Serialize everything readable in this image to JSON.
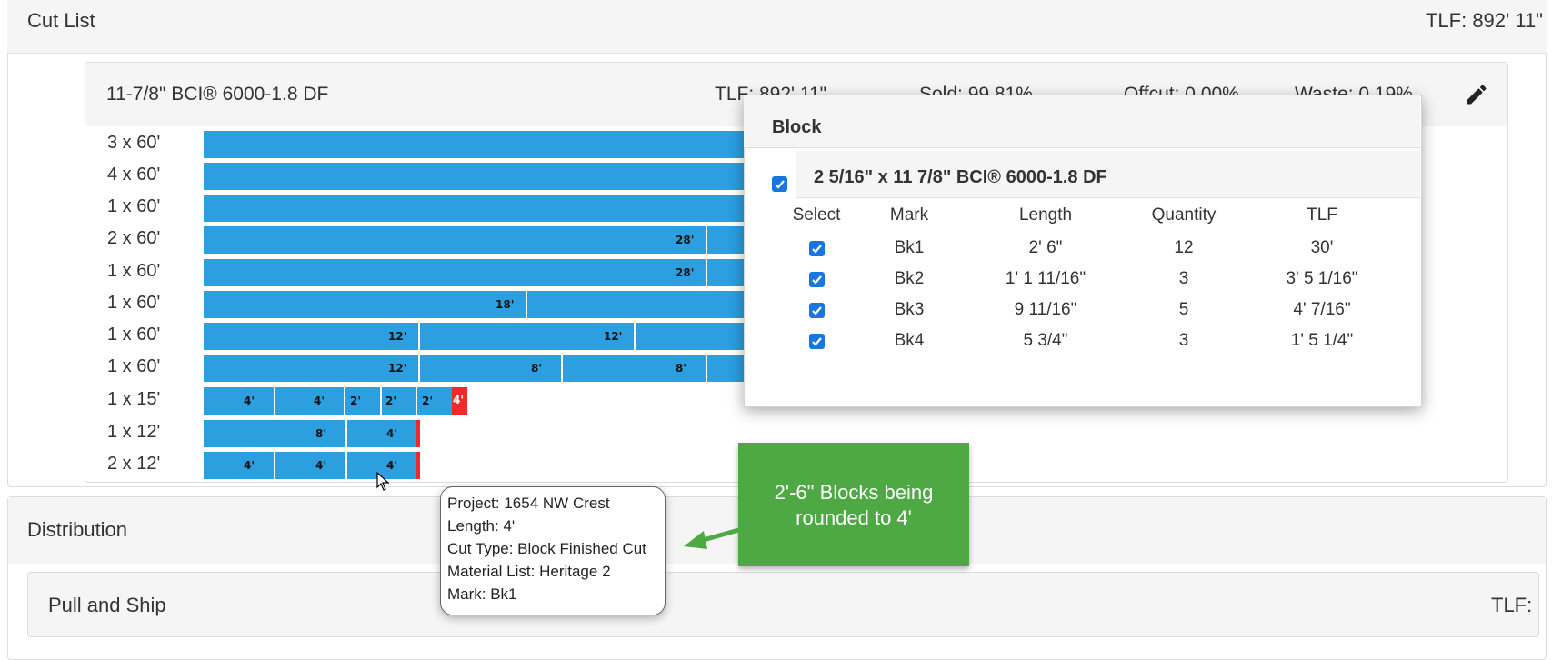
{
  "cut_list": {
    "title": "Cut List",
    "tlf": "TLF: 892' 11\""
  },
  "product": {
    "title": "11-7/8\" BCI® 6000-1.8 DF",
    "tlf": "TLF: 892' 11\"",
    "sold": "Sold: 99.81%",
    "offcut": "Offcut: 0.00%",
    "waste": "Waste: 0.19%",
    "edit_icon": "pencil-icon"
  },
  "rows": [
    {
      "label": "3 x 60'",
      "segments": []
    },
    {
      "label": "4 x 60'",
      "segments": []
    },
    {
      "label": "1 x 60'",
      "segments": []
    },
    {
      "label": "2 x 60'",
      "segments": [
        "28'"
      ]
    },
    {
      "label": "1 x 60'",
      "segments": [
        "28'"
      ]
    },
    {
      "label": "1 x 60'",
      "segments": [
        "18'"
      ]
    },
    {
      "label": "1 x 60'",
      "segments": [
        "12'",
        "12'"
      ]
    },
    {
      "label": "1 x 60'",
      "segments": [
        "12'",
        "8'",
        "8'"
      ]
    },
    {
      "label": "1 x 15'",
      "segments": [
        "4'",
        "4'",
        "2'",
        "2'",
        "2'"
      ],
      "waste": "4'"
    },
    {
      "label": "1 x 12'",
      "segments": [
        "8'",
        "4'"
      ]
    },
    {
      "label": "2 x 12'",
      "segments": [
        "4'",
        "4'",
        "4'"
      ]
    }
  ],
  "block_popup": {
    "title": "Block",
    "group_title": "2 5/16\" x 11 7/8\" BCI® 6000-1.8 DF",
    "columns": [
      "Select",
      "Mark",
      "Length",
      "Quantity",
      "TLF"
    ],
    "items": [
      {
        "mark": "Bk1",
        "length": "2' 6\"",
        "quantity": "12",
        "tlf": "30'"
      },
      {
        "mark": "Bk2",
        "length": "1' 1 11/16\"",
        "quantity": "3",
        "tlf": "3' 5 1/16\""
      },
      {
        "mark": "Bk3",
        "length": "9 11/16\"",
        "quantity": "5",
        "tlf": "4' 7/16\""
      },
      {
        "mark": "Bk4",
        "length": "5 3/4\"",
        "quantity": "3",
        "tlf": "1' 5 1/4\""
      }
    ]
  },
  "tooltip": {
    "lines": [
      "Project: 1654 NW Crest",
      "Length: 4'",
      "Cut Type: Block Finished Cut",
      "Material List: Heritage 2",
      "Mark: Bk1"
    ]
  },
  "callout": {
    "line1": "2'-6\" Blocks being",
    "line2": "rounded to 4'"
  },
  "distribution": {
    "title": "Distribution",
    "pull_title": "Pull and Ship",
    "pull_tlf": "TLF:"
  },
  "colors": {
    "bar": "#2b9fe0",
    "waste": "#ee2b2b",
    "callout": "#4ea844",
    "checkbox": "#1976e0"
  }
}
